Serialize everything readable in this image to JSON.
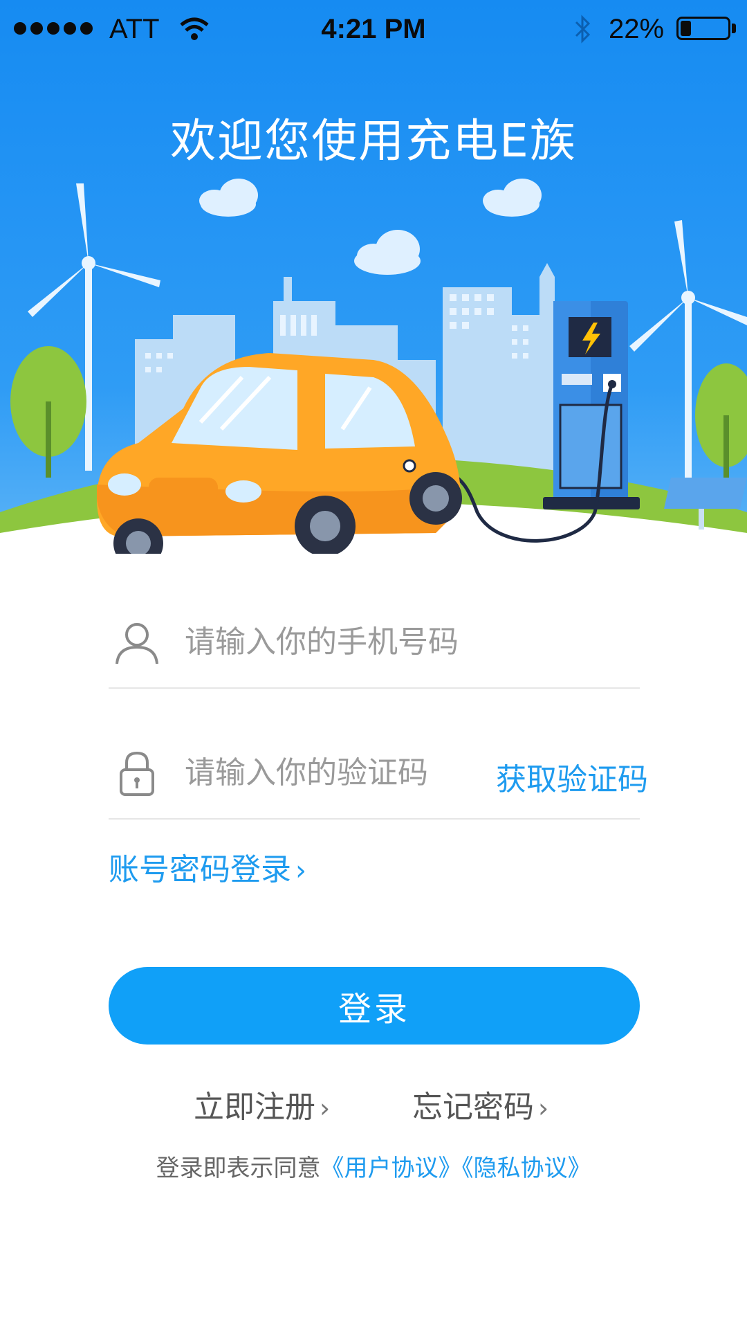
{
  "status_bar": {
    "carrier": "ATT",
    "time": "4:21 PM",
    "battery_percent": "22%",
    "battery_level": 0.22,
    "icons": [
      "signal-dots-icon",
      "wifi-icon",
      "bluetooth-icon",
      "battery-icon"
    ]
  },
  "hero": {
    "title": "欢迎您使用充电E族",
    "illustration": "electric-car-charging-illustration"
  },
  "form": {
    "phone_placeholder": "请输入你的手机号码",
    "phone_value": "",
    "code_placeholder": "请输入你的验证码",
    "code_value": "",
    "get_code_label": "获取验证码",
    "account_login_label": "账号密码登录",
    "chevron": "›"
  },
  "login_button": {
    "label": "登录"
  },
  "links": {
    "register": "立即注册",
    "forgot_password": "忘记密码"
  },
  "agreement": {
    "prefix": "登录即表示同意",
    "user_agreement": "《用户协议》",
    "privacy_agreement": "《隐私协议》"
  },
  "colors": {
    "sky_top": "#1a8cf0",
    "accent": "#1e9bef",
    "button": "#10a0f8",
    "car": "#ffa726"
  }
}
